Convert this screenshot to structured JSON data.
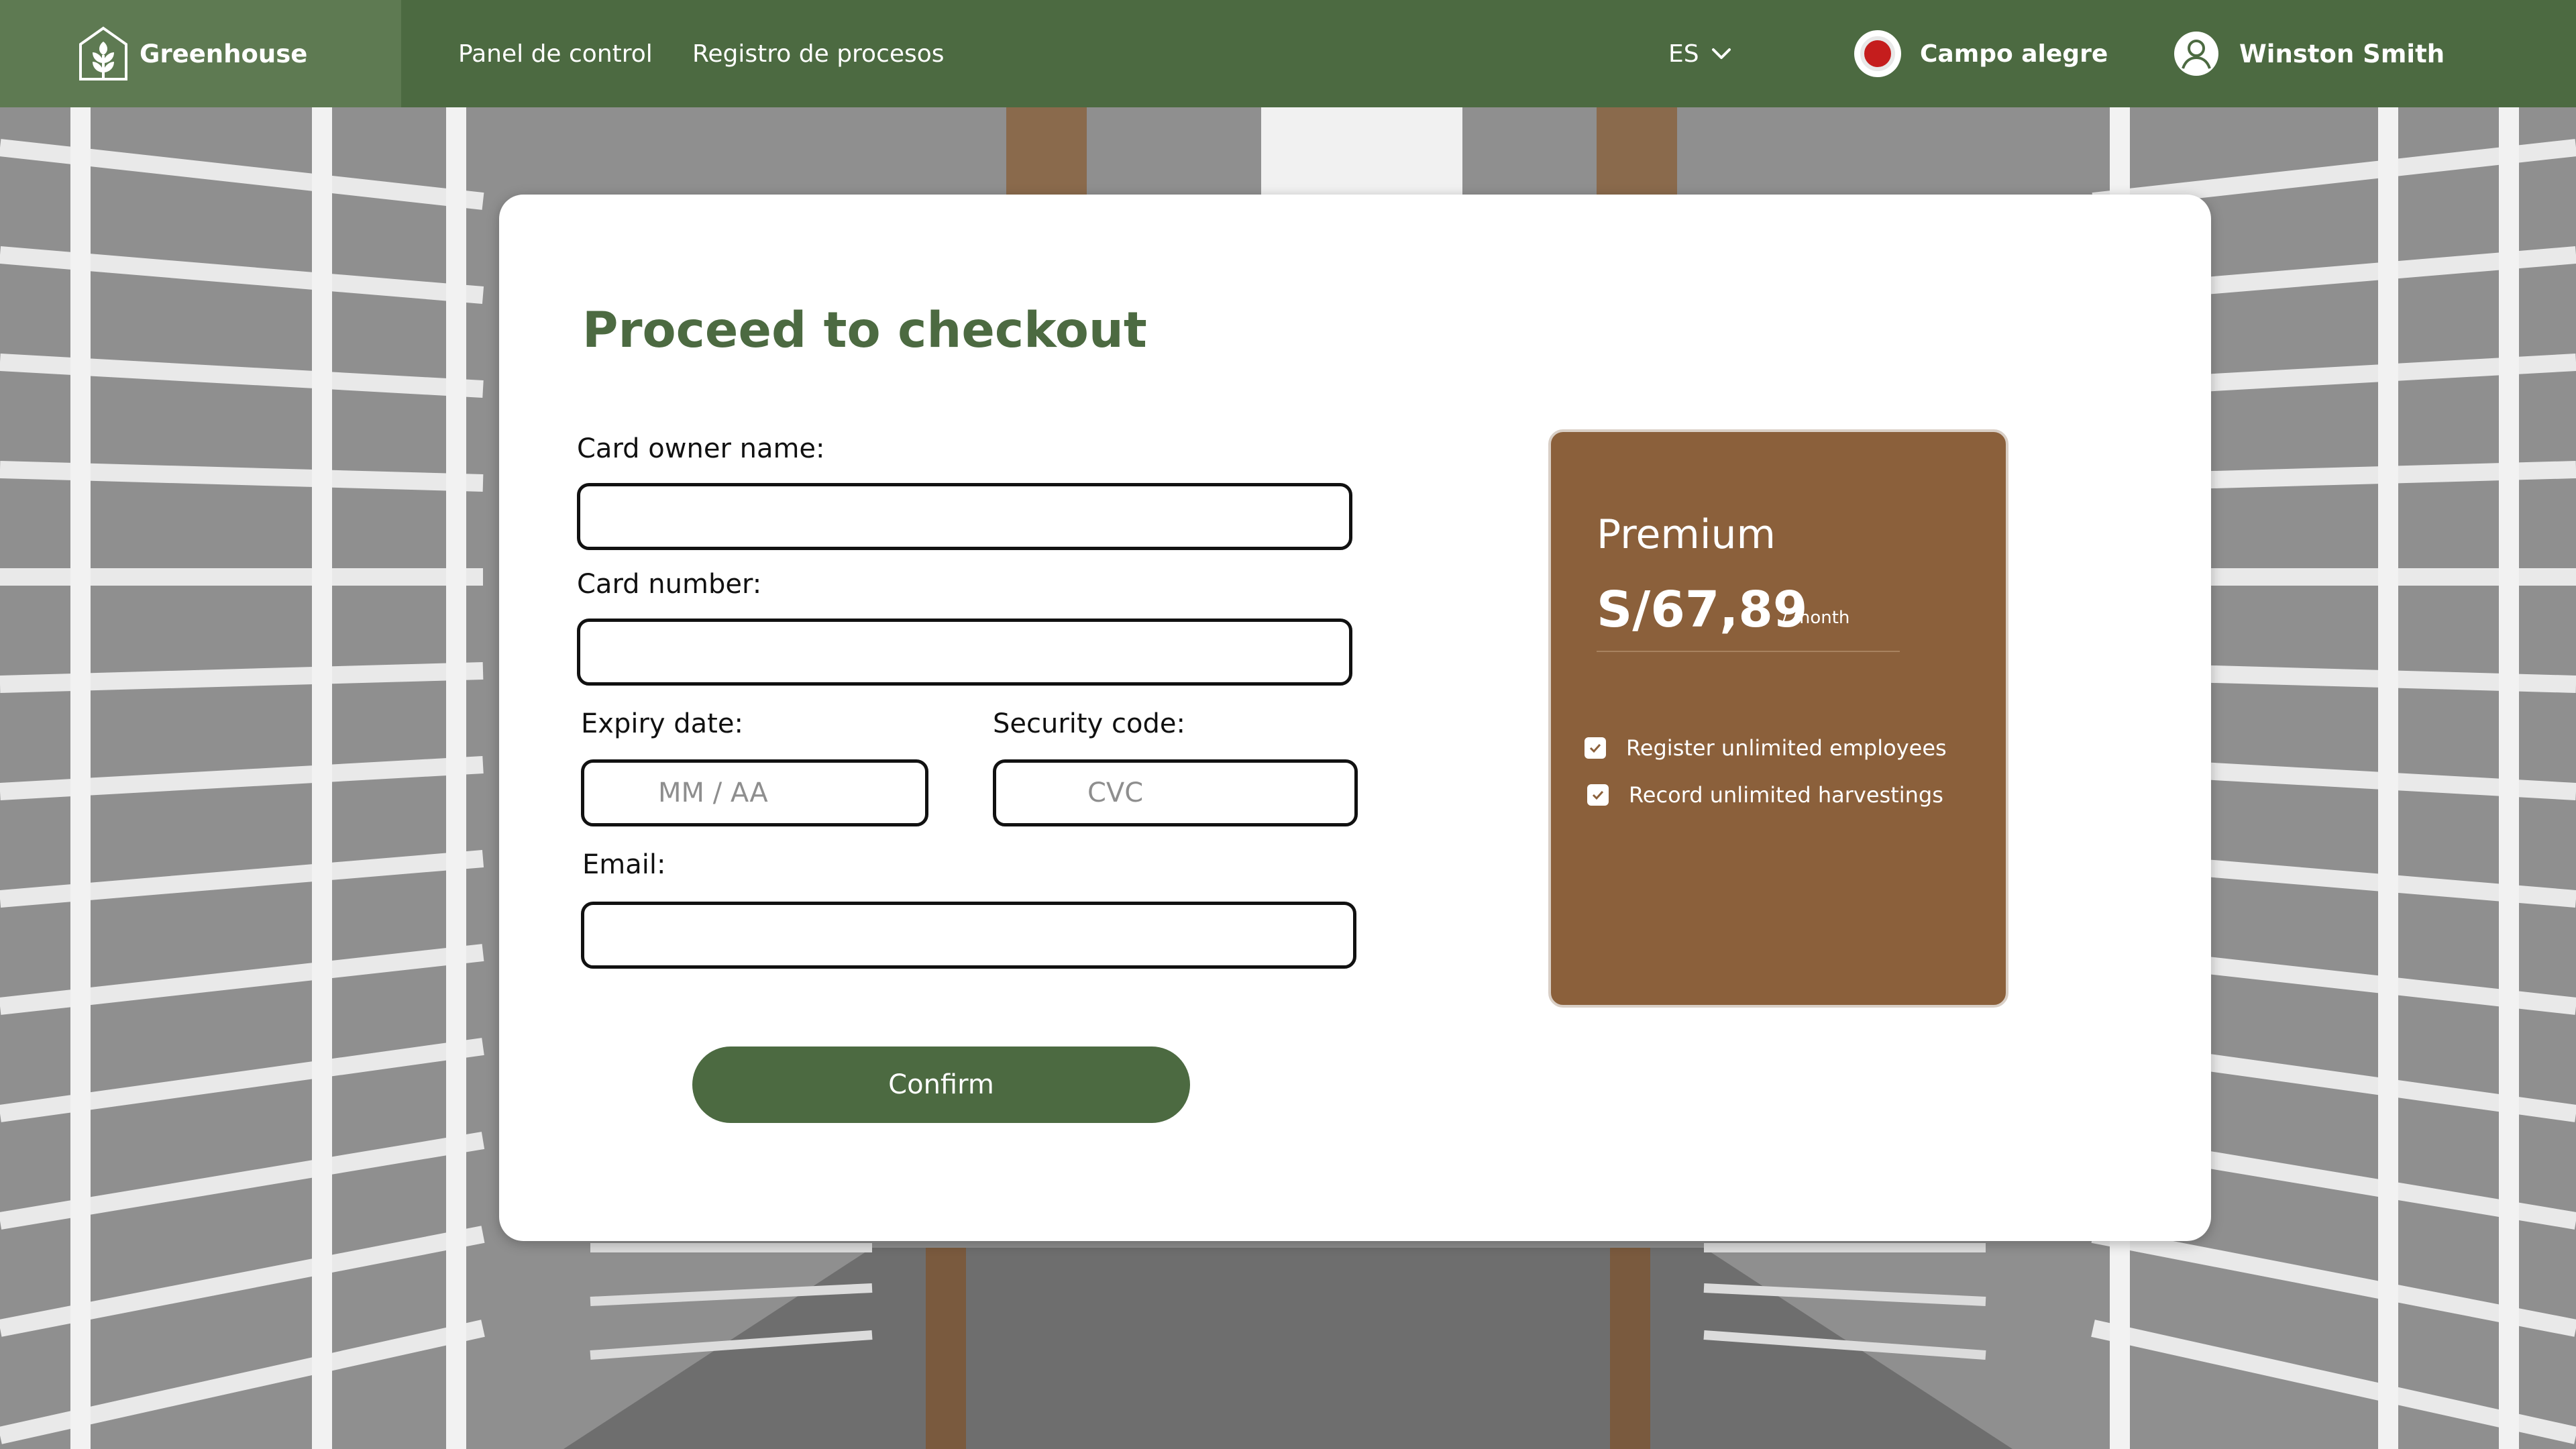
{
  "header": {
    "brand_name": "Greenhouse",
    "nav": [
      "Panel de control",
      "Registro de procesos"
    ],
    "language": "ES",
    "farm_name": "Campo alegre",
    "user_name": "Winston Smith"
  },
  "checkout": {
    "title": "Proceed to checkout",
    "card_owner_label": "Card owner name:",
    "card_number_label": "Card number:",
    "expiry_label": "Expiry date:",
    "expiry_placeholder": "MM / AA",
    "security_label": "Security code:",
    "security_placeholder": "CVC",
    "email_label": "Email:",
    "confirm_label": "Confirm"
  },
  "plan": {
    "name": "Premium",
    "price": "S/67,89",
    "period": "/ month",
    "features": [
      "Register unlimited employees",
      "Record unlimited harvestings"
    ]
  },
  "colors": {
    "header_green": "#4c6a41",
    "brand_green": "#5e7a52",
    "plan_brown": "#8b603b",
    "title_green": "#4c6a41"
  },
  "icons": [
    "greenhouse-logo-icon",
    "chevron-down-icon",
    "farm-avatar-icon",
    "user-avatar-icon",
    "checkbox-checked-icon"
  ]
}
